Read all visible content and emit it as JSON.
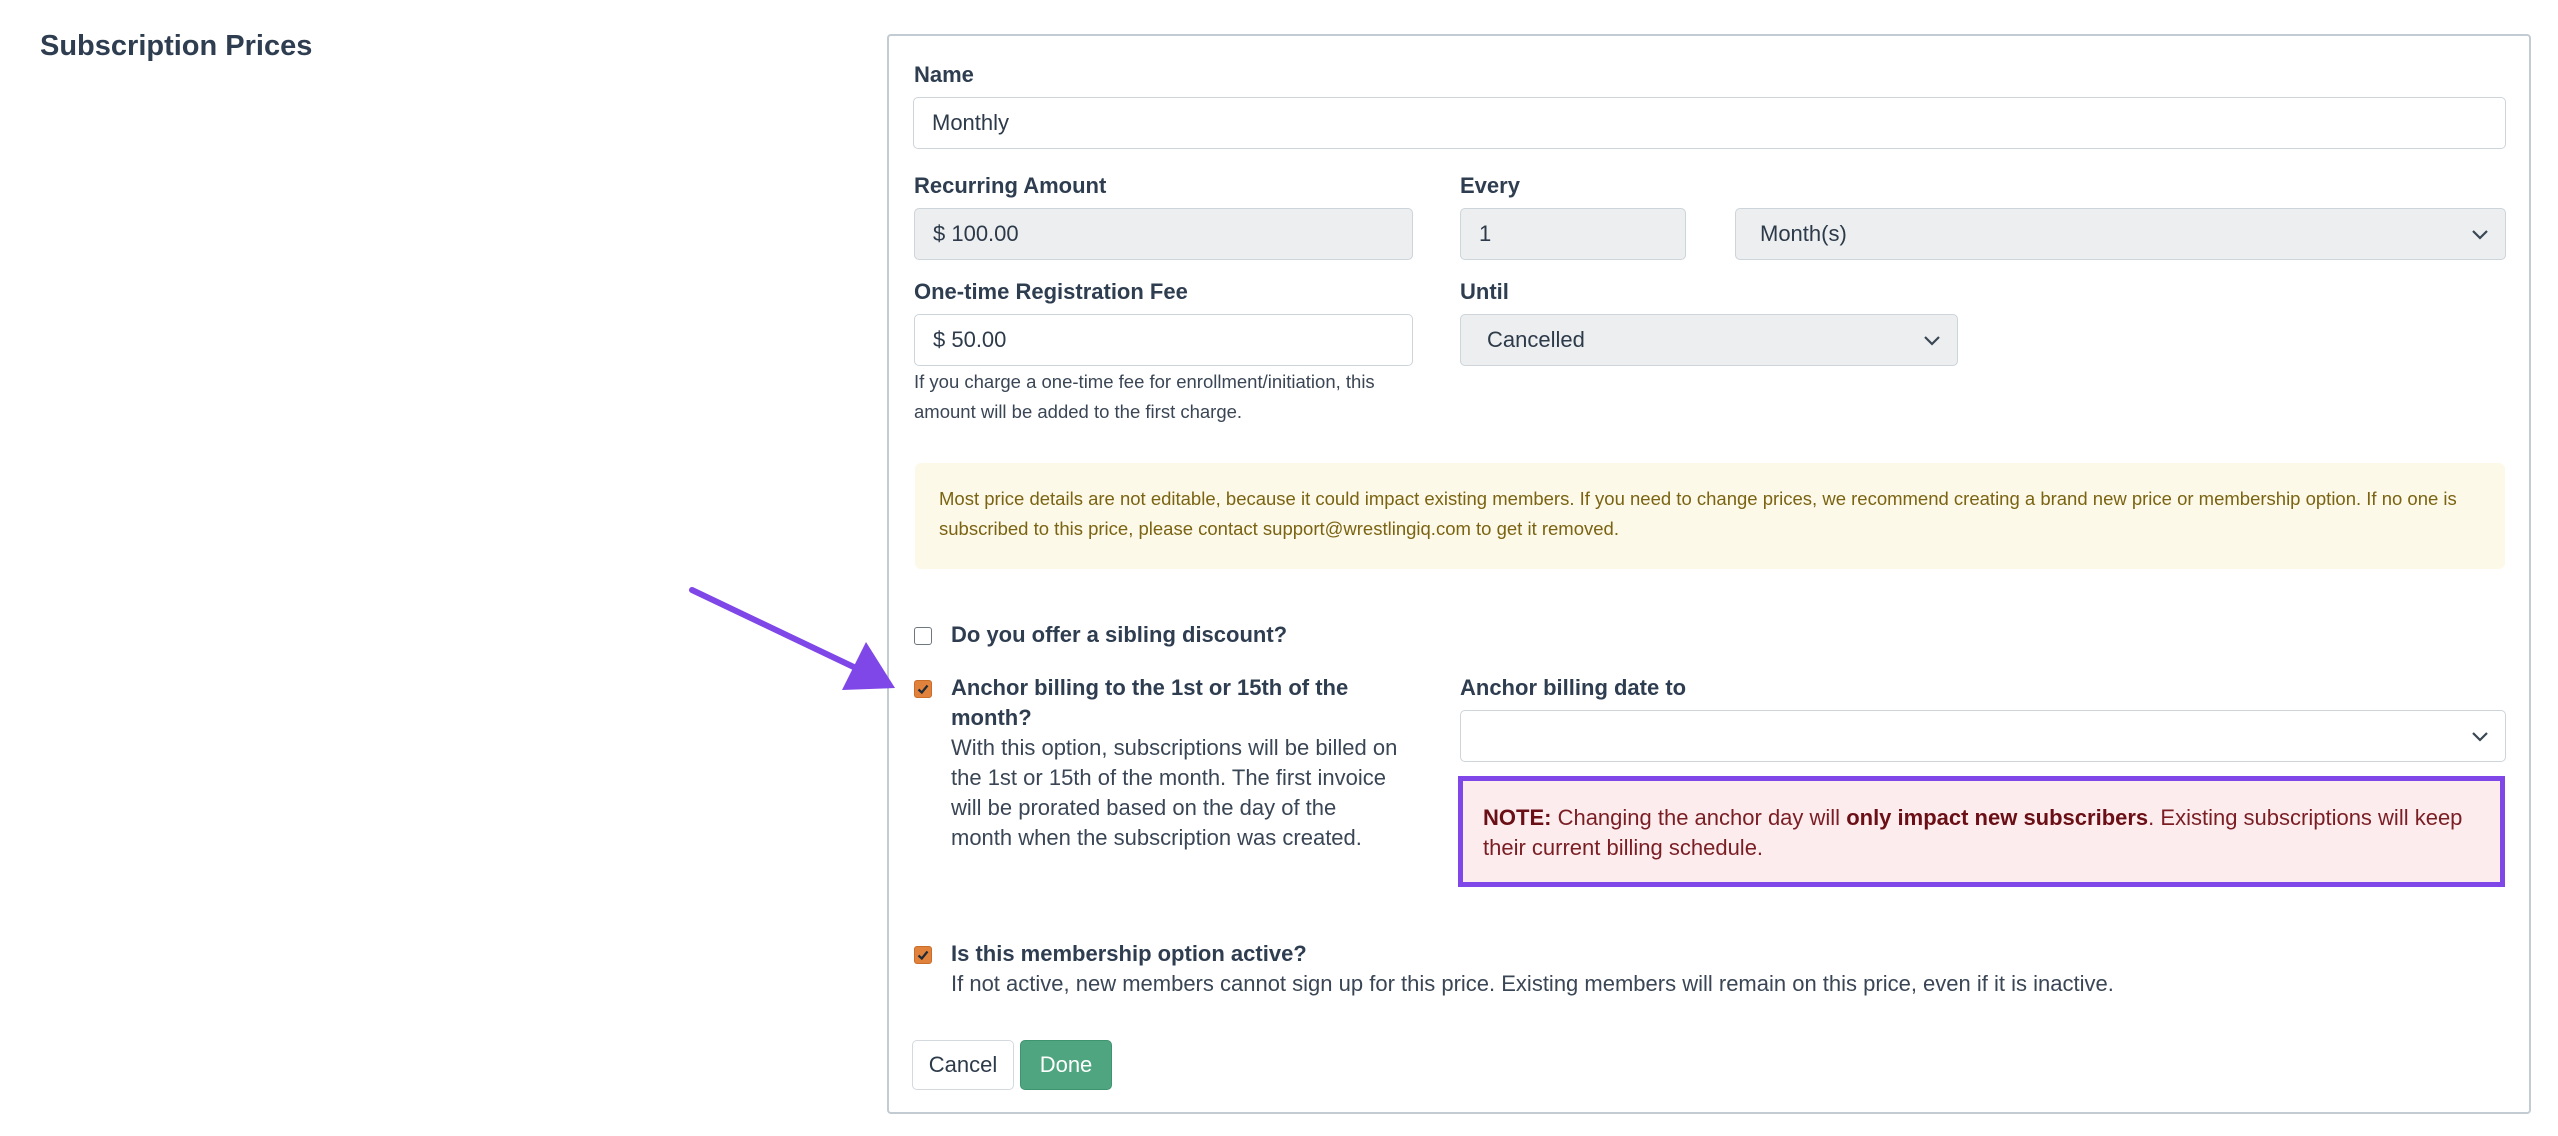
{
  "section": {
    "title": "Subscription Prices"
  },
  "form": {
    "name": {
      "label": "Name",
      "value": "Monthly"
    },
    "recurring_amount": {
      "label": "Recurring Amount",
      "value": "$ 100.00"
    },
    "every": {
      "label": "Every",
      "value": "1",
      "unit": "Month(s)"
    },
    "registration_fee": {
      "label": "One-time Registration Fee",
      "value": "$ 50.00",
      "help_line1": "If you charge a one-time fee for enrollment/initiation, this",
      "help_line2": "amount will be added to the first charge."
    },
    "until": {
      "label": "Until",
      "value": "Cancelled"
    },
    "notice": {
      "line1": "Most price details are not editable, because it could impact existing members. If you need to change prices, we recommend creating a brand new price or membership option. If no one is",
      "line2": "subscribed to this price, please contact support@wrestlingiq.com to get it removed."
    },
    "sibling_discount": {
      "label": "Do you offer a sibling discount?",
      "checked": false
    },
    "anchor_billing": {
      "label_line1": "Anchor billing to the 1st or 15th of the",
      "label_line2": "month?",
      "desc_lines": [
        "With this option, subscriptions will be billed on",
        "the 1st or 15th of the month. The first invoice",
        "will be prorated based on the day of the",
        "month when the subscription was created."
      ],
      "checked": true
    },
    "anchor_date": {
      "label": "Anchor billing date to",
      "value": ""
    },
    "anchor_note": {
      "prefix": "NOTE:",
      "text1": " Changing the anchor day will ",
      "emphasis": "only impact new subscribers",
      "text2": ". Existing subscriptions will keep",
      "line2": "their current billing schedule."
    },
    "active": {
      "label": "Is this membership option active?",
      "desc": "If not active, new members cannot sign up for this price. Existing members will remain on this price, even if it is inactive.",
      "checked": true
    },
    "buttons": {
      "cancel": "Cancel",
      "done": "Done"
    }
  },
  "colors": {
    "checkbox_checked": "#e0823c",
    "done_button": "#4fa57f",
    "annotation_purple": "#7f46e8",
    "notice_bg": "#fdf9e8",
    "note_bg": "#fcecee"
  },
  "icons": {
    "select_caret": "chevron-down-icon",
    "checkmark": "check-icon",
    "annotation": "arrow-annotation"
  }
}
